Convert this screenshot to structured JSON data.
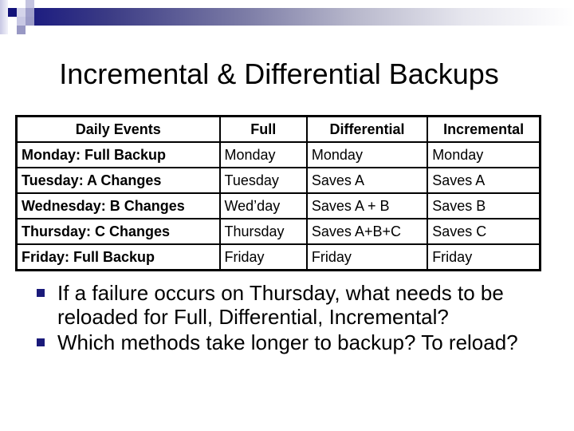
{
  "slide": {
    "title": "Incremental & Differential Backups",
    "accent_color": "#1a1a80",
    "table": {
      "headers": [
        "Daily Events",
        "Full",
        "Differential",
        "Incremental"
      ],
      "rows": [
        [
          "Monday: Full Backup",
          "Monday",
          "Monday",
          "Monday"
        ],
        [
          "Tuesday: A Changes",
          "Tuesday",
          "Saves A",
          "Saves A"
        ],
        [
          "Wednesday: B Changes",
          "Wed’day",
          "Saves A + B",
          "Saves B"
        ],
        [
          "Thursday: C Changes",
          "Thursday",
          "Saves A+B+C",
          "Saves C"
        ],
        [
          "Friday: Full Backup",
          "Friday",
          "Friday",
          "Friday"
        ]
      ]
    },
    "bullets": [
      {
        "icon": "square-bullet-icon",
        "text": "If a failure occurs on Thursday, what needs to be reloaded for Full, Differential, Incremental?"
      },
      {
        "icon": "square-bullet-icon",
        "text": "Which methods take longer to backup? To reload?"
      }
    ]
  }
}
